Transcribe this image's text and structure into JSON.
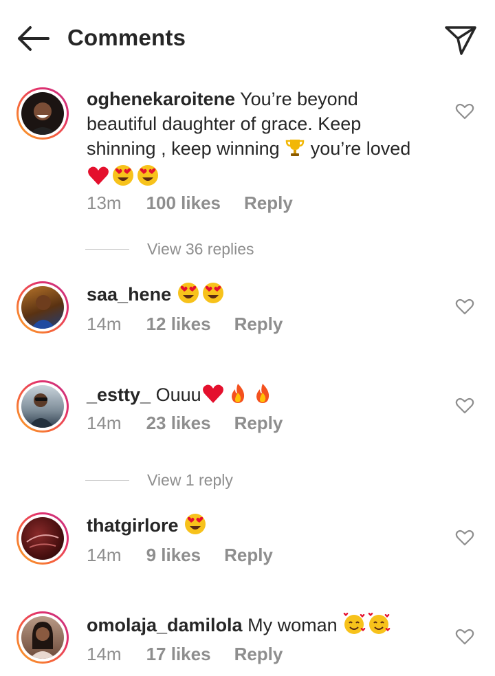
{
  "header": {
    "title": "Comments",
    "back_icon": "arrow-left-icon",
    "share_icon": "paper-plane-icon"
  },
  "comments": [
    {
      "username": "oghenekaroitene",
      "text": "You’re beyond beautiful daughter of grace. Keep shinning , keep winning",
      "text_after_trophy": "you’re loved",
      "time": "13m",
      "likes": "100 likes",
      "reply": "Reply",
      "view_replies": "View 36 replies"
    },
    {
      "username": "saa_hene",
      "text": "",
      "time": "14m",
      "likes": "12 likes",
      "reply": "Reply"
    },
    {
      "username": "_estty_",
      "text": "Ouuu",
      "time": "14m",
      "likes": "23 likes",
      "reply": "Reply",
      "view_replies": "View 1 reply"
    },
    {
      "username": "thatgirlore",
      "text": "",
      "time": "14m",
      "likes": "9 likes",
      "reply": "Reply"
    },
    {
      "username": "omolaja_damilola",
      "text": "My woman",
      "time": "14m",
      "likes": "17 likes",
      "reply": "Reply"
    }
  ],
  "colors": {
    "text": "#262626",
    "secondary": "#8e8e8e",
    "ring_start": "#f9a825",
    "ring_end": "#c13584"
  }
}
